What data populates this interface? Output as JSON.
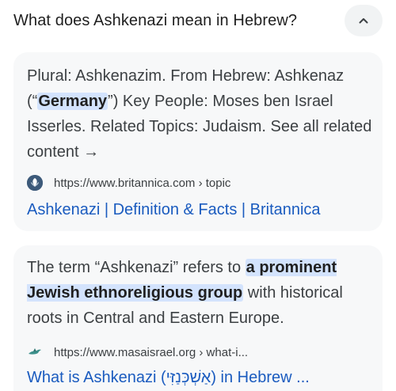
{
  "question": {
    "text": "What does Ashkenazi mean in Hebrew?",
    "collapse_icon": "chevron-up-icon"
  },
  "results": [
    {
      "snippet_before": "Plural: Ashkenazim. From Hebrew: Ashkenaz (“",
      "snippet_highlight": "Germany",
      "snippet_after": "”) Key People: Moses ben Israel Isserles. Related Topics: Judaism. See all related content →",
      "url": "https://www.britannica.com › topic",
      "favicon": "britannica-thistle-icon",
      "title": "Ashkenazi | Definition & Facts | Britannica"
    },
    {
      "snippet_before": "The term “Ashkenazi” refers to ",
      "snippet_highlight": "a prominent Jewish ethnoreligious group",
      "snippet_after": " with historical roots in Central and Eastern Europe.",
      "url": "https://www.masaisrael.org › what-i...",
      "favicon": "masa-israel-bird-icon",
      "title": "What is Ashkenazi (אַשְׁכְּנַזִּי) in Hebrew ..."
    }
  ],
  "colors": {
    "link": "#1a5bbf",
    "highlight": "#d3e3fd",
    "card_background": "#f7f8f9"
  }
}
